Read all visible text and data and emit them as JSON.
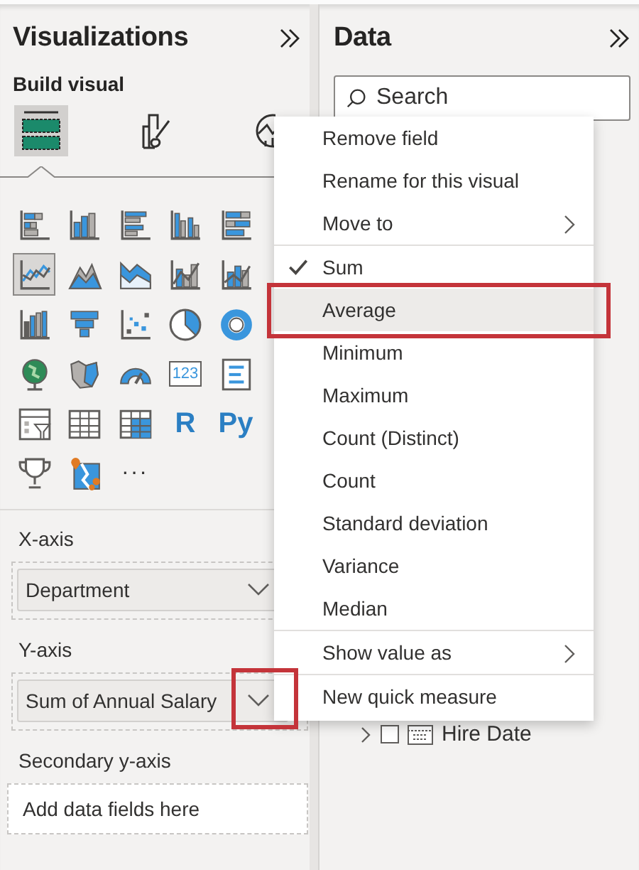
{
  "visualizations": {
    "title": "Visualizations",
    "subtitle": "Build visual",
    "pane_tabs": [
      {
        "selected": true
      },
      {
        "selected": false
      },
      {
        "selected": false
      }
    ],
    "visual_types": [
      {
        "kind": "icon",
        "selected": false
      },
      {
        "kind": "icon",
        "selected": false
      },
      {
        "kind": "icon",
        "selected": false
      },
      {
        "kind": "icon",
        "selected": false
      },
      {
        "kind": "icon",
        "selected": false
      },
      {
        "kind": "icon",
        "selected": true
      },
      {
        "kind": "icon",
        "selected": false
      },
      {
        "kind": "icon",
        "selected": false
      },
      {
        "kind": "icon",
        "selected": false
      },
      {
        "kind": "icon",
        "selected": false
      },
      {
        "kind": "icon",
        "selected": false
      },
      {
        "kind": "icon",
        "selected": false
      },
      {
        "kind": "icon",
        "selected": false
      },
      {
        "kind": "icon",
        "selected": false
      },
      {
        "kind": "icon",
        "selected": false
      },
      {
        "kind": "icon",
        "selected": false
      },
      {
        "kind": "icon",
        "selected": false
      },
      {
        "kind": "icon",
        "selected": false
      },
      {
        "kind": "card",
        "label": "123",
        "selected": false
      },
      {
        "kind": "icon",
        "selected": false
      },
      {
        "kind": "icon",
        "selected": false
      },
      {
        "kind": "icon",
        "selected": false
      },
      {
        "kind": "icon",
        "selected": false
      },
      {
        "kind": "text",
        "label": "R",
        "selected": false
      },
      {
        "kind": "text",
        "label": "Py",
        "selected": false
      },
      {
        "kind": "icon",
        "selected": false
      },
      {
        "kind": "icon",
        "selected": false
      },
      {
        "kind": "more",
        "label": "···",
        "selected": false
      }
    ],
    "wells": [
      {
        "label": "X-axis",
        "field": "Department",
        "highlighted": false
      },
      {
        "label": "Y-axis",
        "field": "Sum of Annual Salary",
        "highlighted": true
      },
      {
        "label": "Secondary y-axis",
        "placeholder": "Add data fields here"
      }
    ]
  },
  "data": {
    "title": "Data",
    "search": {
      "placeholder": "Search"
    },
    "fields": [
      {
        "name": "Hire Date",
        "expanded": false,
        "checked": false
      }
    ]
  },
  "context_menu": {
    "items": [
      {
        "kind": "item",
        "label": "Remove field",
        "checked": false,
        "highlighted": false,
        "submenu": false
      },
      {
        "kind": "item",
        "label": "Rename for this visual",
        "checked": false,
        "highlighted": false,
        "submenu": false
      },
      {
        "kind": "item",
        "label": "Move to",
        "checked": false,
        "highlighted": false,
        "submenu": true
      },
      {
        "kind": "separator"
      },
      {
        "kind": "item",
        "label": "Sum",
        "checked": true,
        "highlighted": false,
        "submenu": false
      },
      {
        "kind": "item",
        "label": "Average",
        "checked": false,
        "highlighted": true,
        "submenu": false
      },
      {
        "kind": "item",
        "label": "Minimum",
        "checked": false,
        "highlighted": false,
        "submenu": false
      },
      {
        "kind": "item",
        "label": "Maximum",
        "checked": false,
        "highlighted": false,
        "submenu": false
      },
      {
        "kind": "item",
        "label": "Count (Distinct)",
        "checked": false,
        "highlighted": false,
        "submenu": false
      },
      {
        "kind": "item",
        "label": "Count",
        "checked": false,
        "highlighted": false,
        "submenu": false
      },
      {
        "kind": "item",
        "label": "Standard deviation",
        "checked": false,
        "highlighted": false,
        "submenu": false
      },
      {
        "kind": "item",
        "label": "Variance",
        "checked": false,
        "highlighted": false,
        "submenu": false
      },
      {
        "kind": "item",
        "label": "Median",
        "checked": false,
        "highlighted": false,
        "submenu": false
      },
      {
        "kind": "separator"
      },
      {
        "kind": "item",
        "label": "Show value as",
        "checked": false,
        "highlighted": false,
        "submenu": true
      },
      {
        "kind": "separator"
      },
      {
        "kind": "item",
        "label": "New quick measure",
        "checked": false,
        "highlighted": false,
        "submenu": false
      }
    ]
  }
}
